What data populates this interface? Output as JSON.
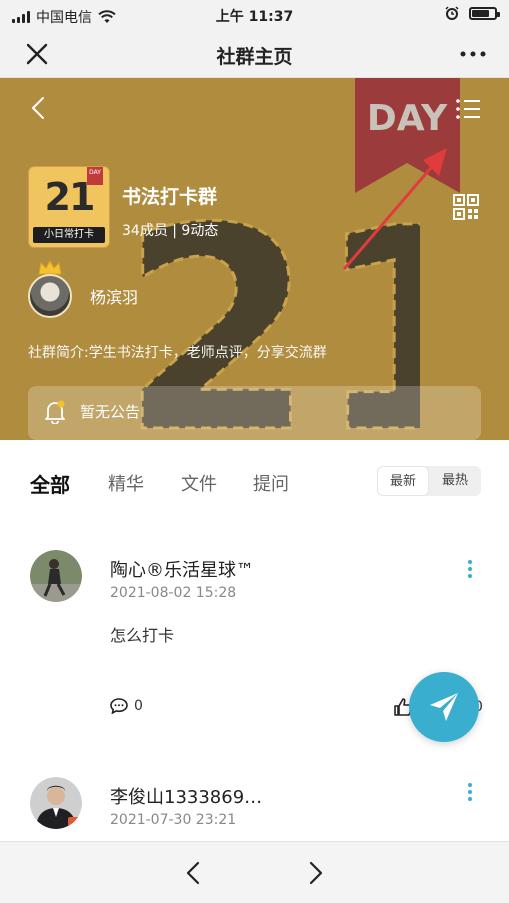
{
  "status": {
    "carrier": "中国电信",
    "time": "上午 11:37",
    "battery_level": 0.7
  },
  "nav": {
    "title": "社群主页"
  },
  "banner": {
    "ribbon_text": "DAY",
    "art_text": "21",
    "colors": {
      "background": "#b08c3f",
      "ribbon": "#9b3b3b",
      "arrow": "#e13c3c"
    }
  },
  "group": {
    "logo_number": "21",
    "logo_ribbon": "DAY",
    "logo_caption": "小日常打卡",
    "name": "书法打卡群",
    "stats": "34成员 | 9动态",
    "owner": "杨滨羽",
    "intro": "社群简介:学生书法打卡，老师点评，分享交流群",
    "notice": "暂无公告"
  },
  "tabs": [
    {
      "label": "全部",
      "active": true
    },
    {
      "label": "精华",
      "active": false
    },
    {
      "label": "文件",
      "active": false
    },
    {
      "label": "提问",
      "active": false
    }
  ],
  "sort": {
    "newest": "最新",
    "hottest": "最热"
  },
  "posts": [
    {
      "author": "陶心®乐活星球™",
      "date": "2021-08-02 15:28",
      "content": "怎么打卡",
      "comments": "0",
      "likes": "0"
    },
    {
      "author": "李俊山1333869…",
      "date": "2021-07-30 23:21"
    }
  ],
  "accent": "#3aaecf"
}
